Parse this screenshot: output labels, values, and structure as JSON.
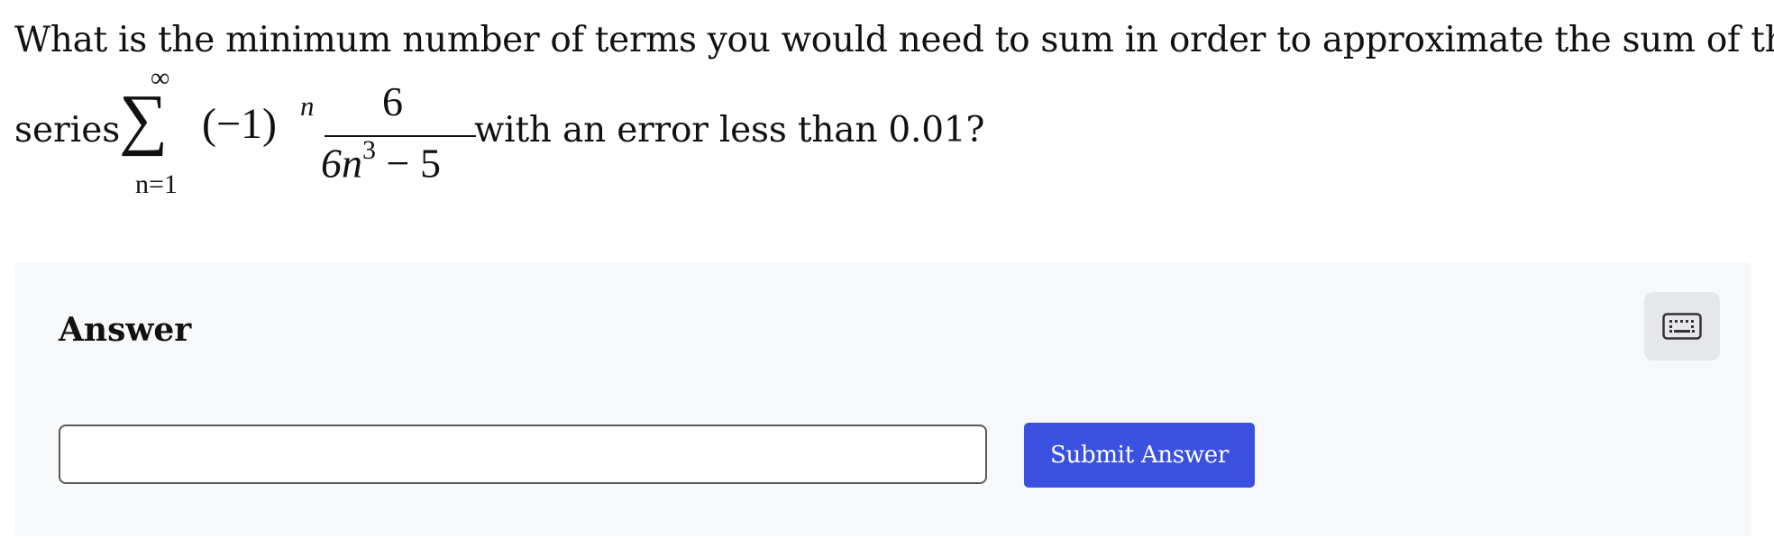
{
  "question": {
    "line1": "What is the minimum number of terms you would need to sum in order to approximate the sum of the",
    "series_word": "series",
    "math": {
      "sum_upper": "∞",
      "sum_lower": "n=1",
      "term_base": "(−1)",
      "term_exponent": "n",
      "numerator": "6",
      "denominator_base": "6n",
      "denominator_power": "3",
      "denominator_rest": "− 5"
    },
    "tail": "with an error less than 0.01?"
  },
  "answer": {
    "label": "Answer",
    "input_value": "",
    "input_placeholder": "",
    "submit_label": "Submit Answer",
    "keyboard_icon": "keyboard-icon"
  },
  "colors": {
    "panel_bg": "#f7f8fa",
    "submit_bg": "#3a51e0",
    "keyboard_bg": "#e6e7ea"
  }
}
